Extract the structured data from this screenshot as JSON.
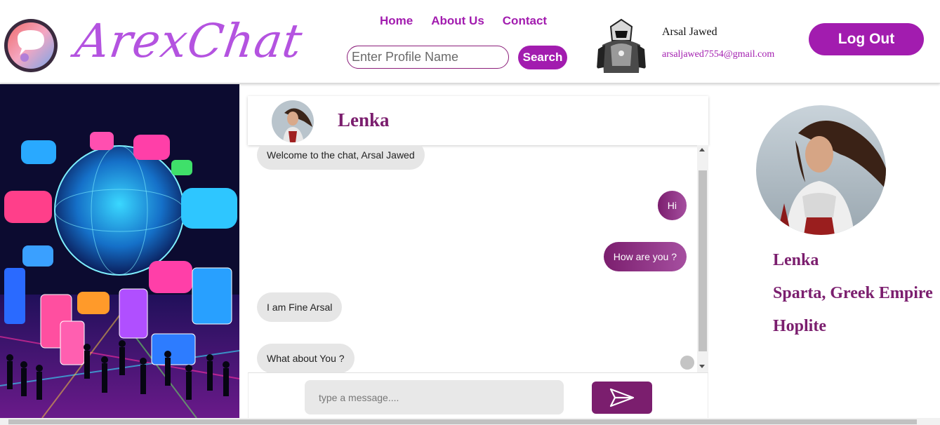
{
  "brand": {
    "name": "ArexChat"
  },
  "nav": {
    "items": [
      "Home",
      "About Us",
      "Contact"
    ]
  },
  "search": {
    "placeholder": "Enter Profile Name",
    "button_label": "Search"
  },
  "user": {
    "name": "Arsal Jawed",
    "email": "arsaljawed7554@gmail.com"
  },
  "logout": {
    "label": "Log Out"
  },
  "chat": {
    "contact_name": "Lenka",
    "messages": [
      {
        "direction": "in",
        "text": "Welcome to the chat, Arsal Jawed"
      },
      {
        "direction": "out",
        "text": "Hi"
      },
      {
        "direction": "out",
        "text": "How are you ?"
      },
      {
        "direction": "in",
        "text": "I am Fine Arsal"
      },
      {
        "direction": "in",
        "text": "What about You ?"
      }
    ],
    "input_placeholder": "type a message....",
    "send_icon": "send-icon"
  },
  "profile": {
    "name": "Lenka",
    "location": "Sparta, Greek Empire",
    "role": "Hoplite"
  },
  "colors": {
    "accent": "#a21caf",
    "accent_dark": "#7b1e6e",
    "bubble_in": "#e6e6e6"
  }
}
